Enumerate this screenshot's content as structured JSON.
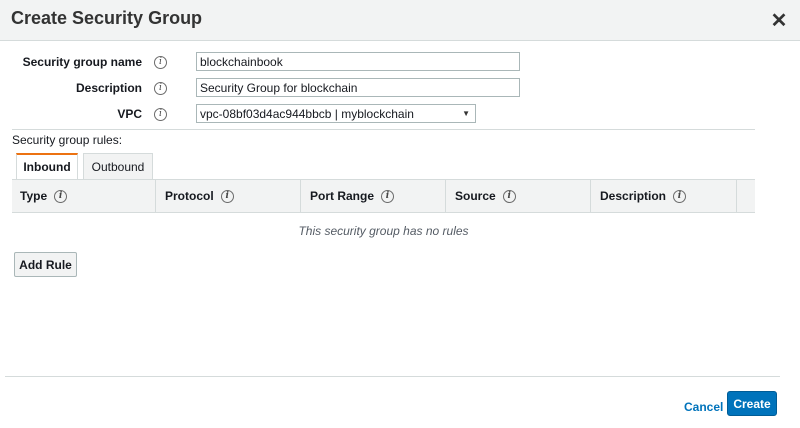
{
  "dialog": {
    "title": "Create Security Group",
    "close_icon": "close-icon"
  },
  "form": {
    "name_label": "Security group name",
    "name_value": "blockchainbook",
    "description_label": "Description",
    "description_value": "Security Group for blockchain",
    "vpc_label": "VPC",
    "vpc_selected": "vpc-08bf03d4ac944bbcb | myblockchain",
    "info_icon_glyph": "i"
  },
  "rules": {
    "section_label": "Security group rules:",
    "tabs": [
      {
        "label": "Inbound",
        "active": true
      },
      {
        "label": "Outbound",
        "active": false
      }
    ],
    "columns": [
      "Type",
      "Protocol",
      "Port Range",
      "Source",
      "Description"
    ],
    "empty_message": "This security group has no rules",
    "add_rule_label": "Add Rule"
  },
  "footer": {
    "cancel_label": "Cancel",
    "create_label": "Create"
  },
  "colors": {
    "accent_tab": "#ec7211",
    "primary_button": "#0073bb",
    "link": "#0073bb"
  }
}
